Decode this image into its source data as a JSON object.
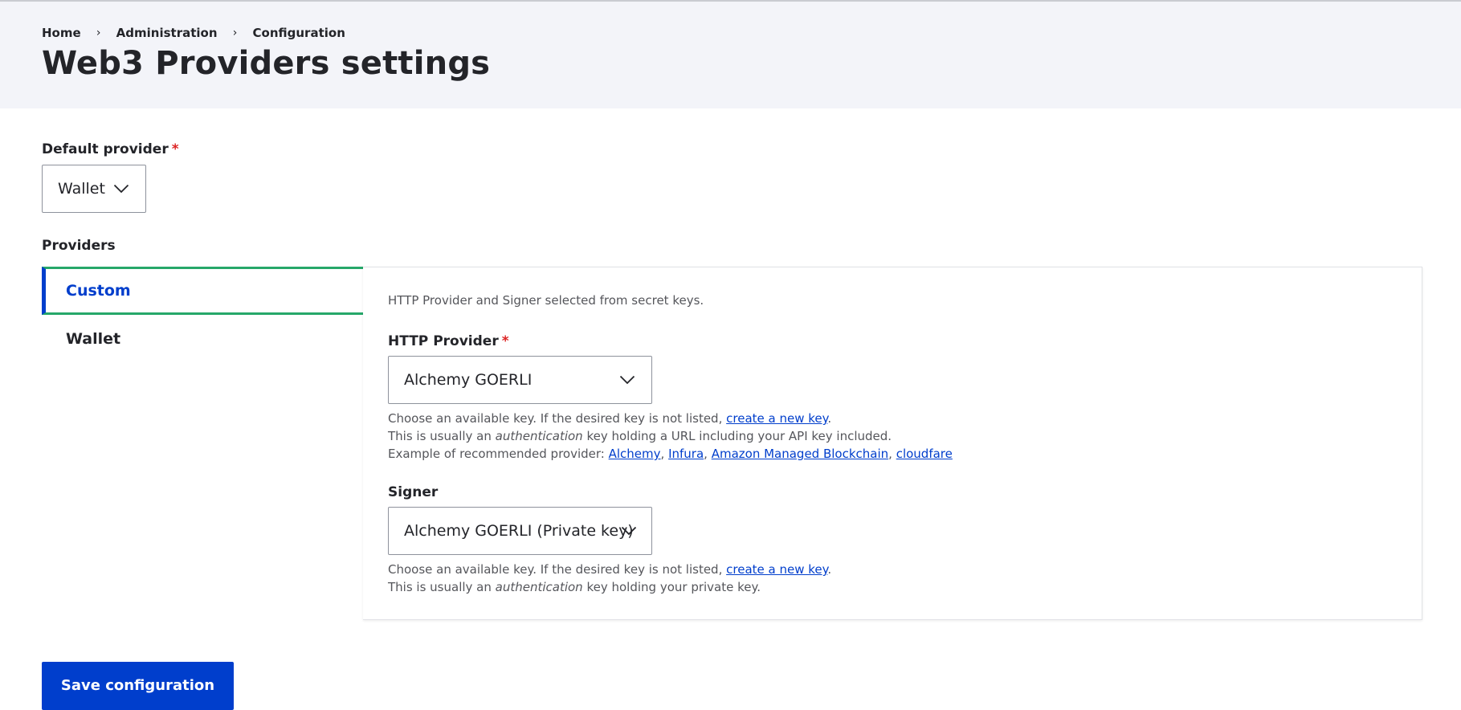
{
  "breadcrumb": {
    "items": [
      "Home",
      "Administration",
      "Configuration"
    ],
    "separator": "›"
  },
  "page": {
    "title": "Web3 Providers settings"
  },
  "default_provider": {
    "label": "Default provider",
    "required_marker": "*",
    "selected": "Wallet"
  },
  "providers": {
    "label": "Providers",
    "tabs": [
      {
        "label": "Custom",
        "active": true
      },
      {
        "label": "Wallet",
        "active": false
      }
    ],
    "custom": {
      "description": "HTTP Provider and Signer selected from secret keys.",
      "http_provider": {
        "label": "HTTP Provider",
        "required_marker": "*",
        "selected": "Alchemy GOERLI",
        "help_line1_prefix": "Choose an available key. If the desired key is not listed, ",
        "help_line1_link": "create a new key",
        "help_line1_suffix": ".",
        "help_line2_prefix": "This is usually an ",
        "help_line2_em": "authentication",
        "help_line2_suffix": " key holding a URL including your API key included.",
        "help_line3_prefix": "Example of recommended provider: ",
        "links": [
          "Alchemy",
          "Infura",
          "Amazon Managed Blockchain",
          "cloudfare"
        ],
        "link_separator": ", "
      },
      "signer": {
        "label": "Signer",
        "selected": "Alchemy GOERLI (Private key)",
        "help_line1_prefix": "Choose an available key. If the desired key is not listed, ",
        "help_line1_link": "create a new key",
        "help_line1_suffix": ".",
        "help_line2_prefix": "This is usually an ",
        "help_line2_em": "authentication",
        "help_line2_suffix": " key holding your private key."
      }
    }
  },
  "actions": {
    "save_label": "Save configuration"
  },
  "colors": {
    "header_bg": "#f3f4f9",
    "primary": "#003ecc",
    "active_tab_accent": "#26a769",
    "required": "#dc2323",
    "text": "#232429",
    "muted_text": "#55565b"
  },
  "icons": {
    "select_arrow": "chevron-down-icon",
    "breadcrumb_separator": "chevron-right-icon"
  }
}
